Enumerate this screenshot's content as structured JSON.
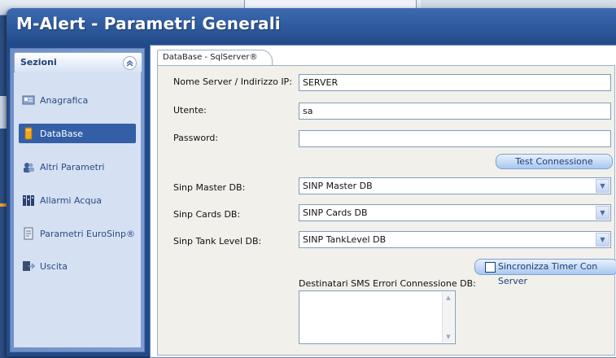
{
  "window": {
    "title": "M-Alert - Parametri Generali"
  },
  "sidebar": {
    "header": "Sezioni",
    "collapse_glyph": "»",
    "items": [
      {
        "label": "Anagrafica",
        "icon": "card-icon",
        "color": "#7b98c4"
      },
      {
        "label": "DataBase",
        "icon": "database-icon",
        "color": "#f0a020",
        "active": true
      },
      {
        "label": "Altri Parametri",
        "icon": "users-icon",
        "color": "#3d5e98"
      },
      {
        "label": "Allarmi Acqua",
        "icon": "water-alarm-icon",
        "color": "#2b3f6d"
      },
      {
        "label": "Parametri EuroSinp®",
        "icon": "document-icon",
        "color": "#5a6d8f"
      },
      {
        "label": "Uscita",
        "icon": "exit-icon",
        "color": "#3b4d70"
      }
    ]
  },
  "tab": {
    "label": "DataBase - SqlServer®"
  },
  "form": {
    "server_label": "Nome Server / Indirizzo IP:",
    "server_value": "SERVER",
    "user_label": "Utente:",
    "user_value": "sa",
    "password_label": "Password:",
    "password_value": "",
    "test_button": "Test Connessione",
    "master_label": "Sinp Master DB:",
    "master_value": "SINP Master DB",
    "cards_label": "Sinp Cards DB:",
    "cards_value": "SINP Cards DB",
    "tank_label": "Sinp Tank Level DB:",
    "tank_value": "SINP TankLevel DB",
    "sync_label": "Sincronizza Timer Con Server",
    "sms_label": "Destinatari SMS Errori Connessione DB:",
    "sms_value": ""
  },
  "colors": {
    "accent": "#345ea6",
    "title_bar": "#2a5597"
  }
}
